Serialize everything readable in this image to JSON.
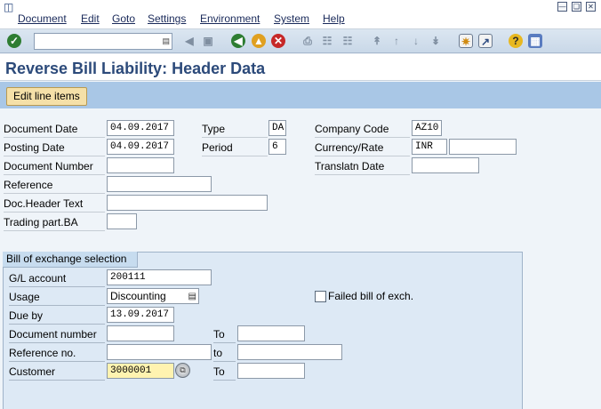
{
  "menu": {
    "items": [
      "Document",
      "Edit",
      "Goto",
      "Settings",
      "Environment",
      "System",
      "Help"
    ]
  },
  "toolbar": {
    "command_value": "",
    "icons": [
      "enter-icon",
      "back-icon",
      "exit-icon",
      "cancel-icon",
      "print-icon",
      "find-icon",
      "find-next-icon",
      "first-page-icon",
      "previous-page-icon",
      "next-page-icon",
      "last-page-icon",
      "create-session-icon",
      "shortcut-icon",
      "help-icon",
      "layout-menu-icon"
    ]
  },
  "page": {
    "title": "Reverse Bill Liability: Header Data"
  },
  "app_toolbar": {
    "edit_line_items": "Edit line items"
  },
  "header": {
    "document_date_label": "Document Date",
    "document_date": "04.09.2017",
    "type_label": "Type",
    "type": "DA",
    "company_code_label": "Company Code",
    "company_code": "AZ10",
    "posting_date_label": "Posting Date",
    "posting_date": "04.09.2017",
    "period_label": "Period",
    "period": "6",
    "currency_rate_label": "Currency/Rate",
    "currency": "INR",
    "rate": "",
    "document_number_label": "Document Number",
    "document_number": "",
    "translation_date_label": "Translatn Date",
    "translation_date": "",
    "reference_label": "Reference",
    "reference": "",
    "doc_header_text_label": "Doc.Header Text",
    "doc_header_text": "",
    "trading_part_label": "Trading part.BA",
    "trading_part": ""
  },
  "selection": {
    "title": "Bill of exchange selection",
    "gl_account_label": "G/L account",
    "gl_account": "200111",
    "usage_label": "Usage",
    "usage": "Discounting",
    "failed_bill_label": "Failed bill of exch.",
    "due_by_label": "Due by",
    "due_by": "13.09.2017",
    "document_number_label": "Document number",
    "document_number_from": "",
    "document_number_to_label": "To",
    "document_number_to": "",
    "reference_no_label": "Reference no.",
    "reference_no_from": "",
    "reference_no_to_label": "to",
    "reference_no_to": "",
    "customer_label": "Customer",
    "customer_from": "3000001",
    "customer_to_label": "To",
    "customer_to": ""
  },
  "colors": {
    "background": "#eff4f9",
    "title": "#2c4a7a",
    "app_toolbar": "#a9c7e6",
    "button": "#f5e0a8",
    "group_box": "#dde9f5",
    "highlight_field": "#fff3b0"
  }
}
